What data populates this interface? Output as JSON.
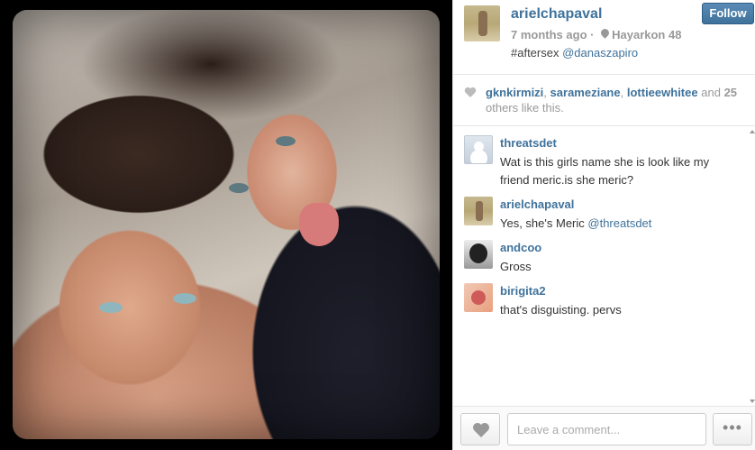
{
  "post": {
    "owner": "arielchapaval",
    "time_ago": "7 months ago",
    "separator": "·",
    "location": "Hayarkon 48",
    "caption_tag": "#aftersex",
    "caption_mention": "@danaszapiro",
    "follow_label": "Follow"
  },
  "likes": {
    "likers": [
      "gknkirmizi",
      "sarameziane",
      "lottieewhitee"
    ],
    "sep": ",",
    "and": "and",
    "count": "25",
    "suffix": "others like this."
  },
  "comments": [
    {
      "user": "threatsdet",
      "text": "Wat is this girls name she is look like my friend meric.is she meric?",
      "mention": ""
    },
    {
      "user": "arielchapaval",
      "text": "Yes, she's Meric",
      "mention": "@threatsdet"
    },
    {
      "user": "andcoo",
      "text": "Gross",
      "mention": ""
    },
    {
      "user": "birigita2",
      "text": "that's disguisting. pervs",
      "mention": ""
    }
  ],
  "footer": {
    "comment_placeholder": "Leave a comment...",
    "more_label": "•••"
  },
  "icons": {
    "heart": "heart-icon",
    "pin": "location-pin-icon"
  },
  "colors": {
    "link": "#3f729b",
    "follow_button": "#3f729b"
  }
}
